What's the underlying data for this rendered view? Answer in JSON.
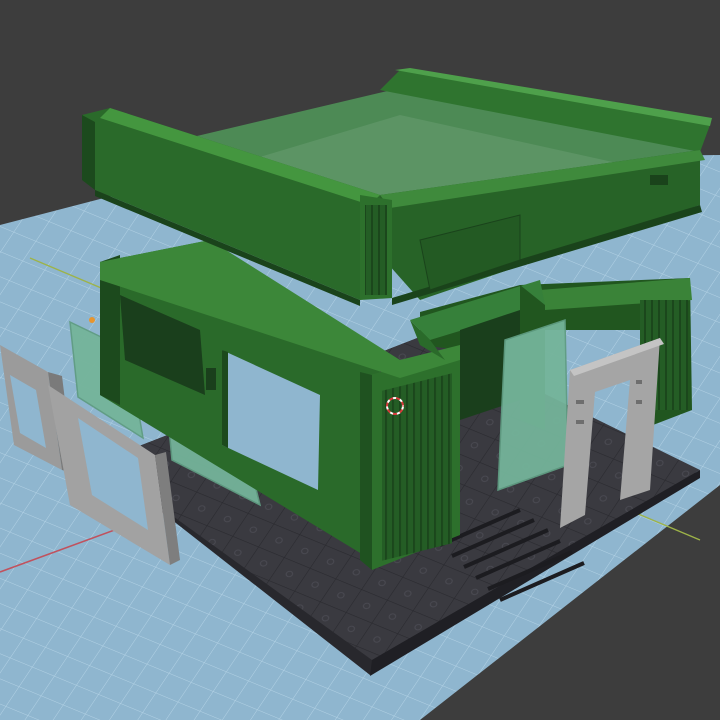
{
  "viewport": {
    "background_color": "#3d3d3d",
    "grid_color": "#8fb6cf",
    "grid_line_color": "#a9cde3",
    "axis_x_color": "#c0525e",
    "axis_y_color": "#9db348"
  },
  "scene": {
    "objects": [
      "upper-green-tray",
      "lower-green-wall-frame",
      "dark-floor-base",
      "translucent-window-panels",
      "grey-door-frames"
    ],
    "materials": {
      "green": "#2a6a2a",
      "green_light": "#3f8a3c",
      "green_dark": "#1c4a1d",
      "floor": "#3c3c43",
      "glass": "#74b49a",
      "frame_grey": "#a8a8a8"
    },
    "cursor_icon": "3d-cursor-icon",
    "origin_icon": "object-origin-icon"
  }
}
